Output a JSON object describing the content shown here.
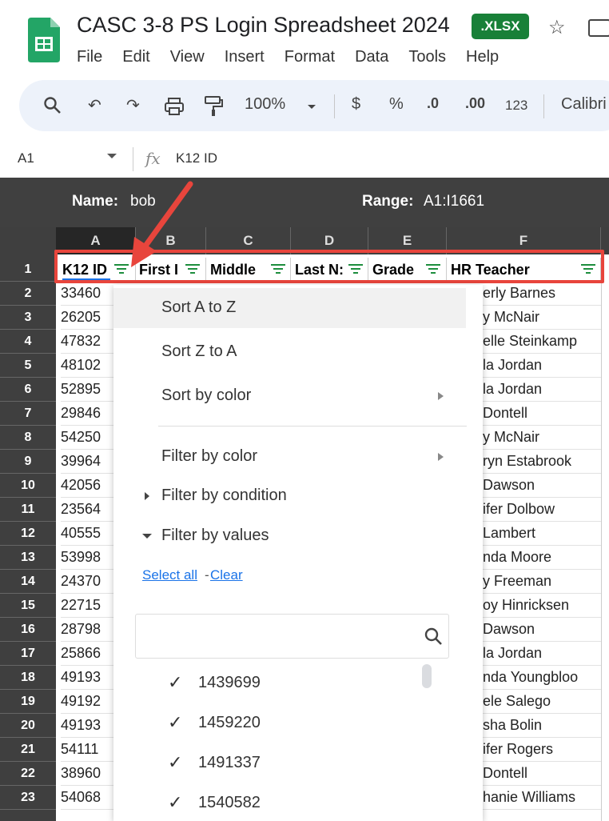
{
  "doc": {
    "title": "CASC 3-8 PS Login Spreadsheet 2024",
    "badge": ".XLSX"
  },
  "menu": [
    "File",
    "Edit",
    "View",
    "Insert",
    "Format",
    "Data",
    "Tools",
    "Help"
  ],
  "toolbar": {
    "zoom": "100%",
    "currency": "$",
    "percent": "%",
    "dec_less": ".0",
    "dec_more": ".00",
    "format123": "123",
    "font": "Calibri"
  },
  "formula_bar": {
    "cell_ref": "A1",
    "fx": "fx",
    "value": "K12 ID"
  },
  "named_range": {
    "name_label": "Name:",
    "name_value": "bob",
    "range_label": "Range:",
    "range_value": "A1:I1661"
  },
  "columns": [
    "A",
    "B",
    "C",
    "D",
    "E",
    "F"
  ],
  "headers": [
    "K12 ID",
    "First I",
    "Middle",
    "Last N:",
    "Grade",
    "HR Teacher"
  ],
  "rows": [
    "1",
    "2",
    "3",
    "4",
    "5",
    "6",
    "7",
    "8",
    "9",
    "10",
    "11",
    "12",
    "13",
    "14",
    "15",
    "16",
    "17",
    "18",
    "19",
    "20",
    "21",
    "22",
    "23"
  ],
  "col_a": [
    "33460",
    "26205",
    "47832",
    "48102",
    "52895",
    "29846",
    "54250",
    "39964",
    "42056",
    "23564",
    "40555",
    "53998",
    "24370",
    "22715",
    "28798",
    "25866",
    "49193",
    "49192",
    "49193",
    "54111",
    "38960",
    "54068"
  ],
  "col_f": [
    "erly Barnes",
    "y McNair",
    "elle Steinkamp",
    "la Jordan",
    "la Jordan",
    "Dontell",
    "y McNair",
    "ryn Estabrook",
    "Dawson",
    "ifer Dolbow",
    "Lambert",
    "nda Moore",
    "y Freeman",
    "oy Hinricksen",
    "Dawson",
    "la Jordan",
    "nda Youngbloo",
    "ele Salego",
    "sha Bolin",
    "ifer Rogers",
    "Dontell",
    "hanie Williams"
  ],
  "dropdown": {
    "sort_az": "Sort A to Z",
    "sort_za": "Sort Z to A",
    "sort_color": "Sort by color",
    "filter_color": "Filter by color",
    "filter_condition": "Filter by condition",
    "filter_values": "Filter by values",
    "select_all": "Select all",
    "dash": "-",
    "clear": "Clear",
    "values": [
      "1439699",
      "1459220",
      "1491337",
      "1540582"
    ]
  },
  "colors": {
    "accent_red": "#e8453c",
    "sheets_green": "#188038",
    "filter_green": "#1e8e3e"
  },
  "icons": [
    "sheets-logo-icon",
    "star-icon",
    "move-folder-icon",
    "search-icon",
    "undo-icon",
    "redo-icon",
    "print-icon",
    "paint-format-icon",
    "filter-icon",
    "checkmark-icon",
    "red-arrow-icon"
  ]
}
